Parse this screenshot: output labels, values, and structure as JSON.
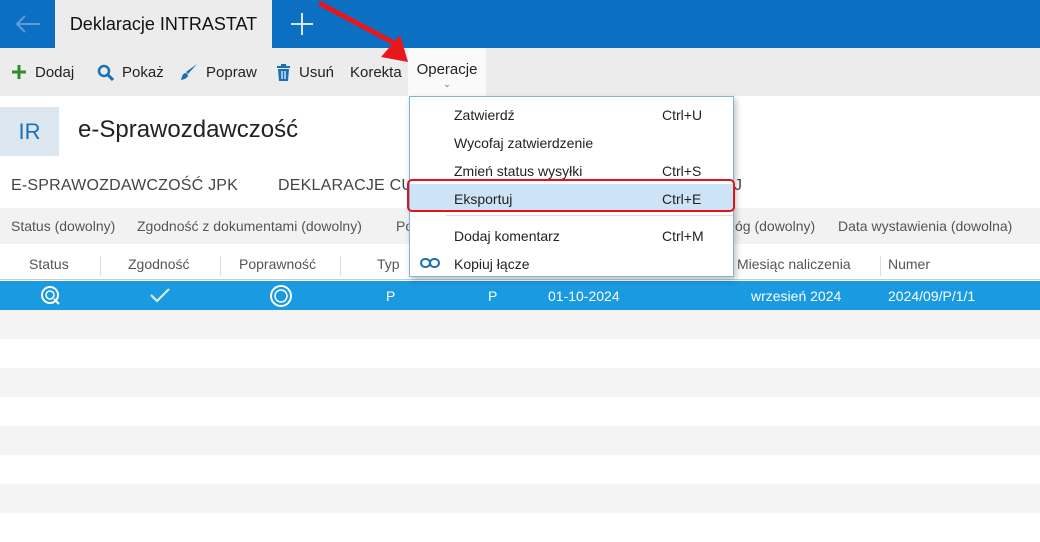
{
  "topbar": {
    "tab_title": "Deklaracje INTRASTAT"
  },
  "toolbar": {
    "add": "Dodaj",
    "show": "Pokaż",
    "edit": "Popraw",
    "delete": "Usuń",
    "correction": "Korekta",
    "operations": "Operacje"
  },
  "header": {
    "badge": "IR",
    "title": "e-Sprawozdawczość"
  },
  "section_tabs": [
    "E-SPRAWOZDAWCZOŚĆ JPK",
    "DEKLARACJE CU"
  ],
  "filters": [
    "Status (dowolny)",
    "Zgodność z dokumentami (dowolny)",
    "Po",
    "óg (dowolny)",
    "Data wystawienia (dowolna)"
  ],
  "columns": [
    "Status",
    "Zgodność",
    "Poprawność",
    "Typ",
    "Miesiąc naliczenia",
    "Numer"
  ],
  "rows": [
    {
      "typ": "P",
      "typ2": "P",
      "date": "01-10-2024",
      "month": "wrzesień 2024",
      "number": "2024/09/P/1/1"
    }
  ],
  "menu": {
    "items": [
      {
        "label": "Zatwierdź",
        "shortcut": "Ctrl+U"
      },
      {
        "label": "Wycofaj zatwierdzenie",
        "shortcut": ""
      },
      {
        "label": "Zmień status wysyłki",
        "shortcut": "Ctrl+S"
      },
      {
        "label": "Eksportuj",
        "shortcut": "Ctrl+E"
      },
      {
        "label": "Dodaj komentarz",
        "shortcut": "Ctrl+M"
      },
      {
        "label": "Kopiuj łącze",
        "shortcut": ""
      }
    ],
    "partial_behind_menu": "J"
  },
  "colors": {
    "topbar": "#0b6fc2",
    "selected_row": "#1a9ae0",
    "highlight": "#cce4f5",
    "annotation": "#e0121a",
    "add_icon": "#2e8b2e",
    "delete_icon": "#1a6fb5"
  }
}
